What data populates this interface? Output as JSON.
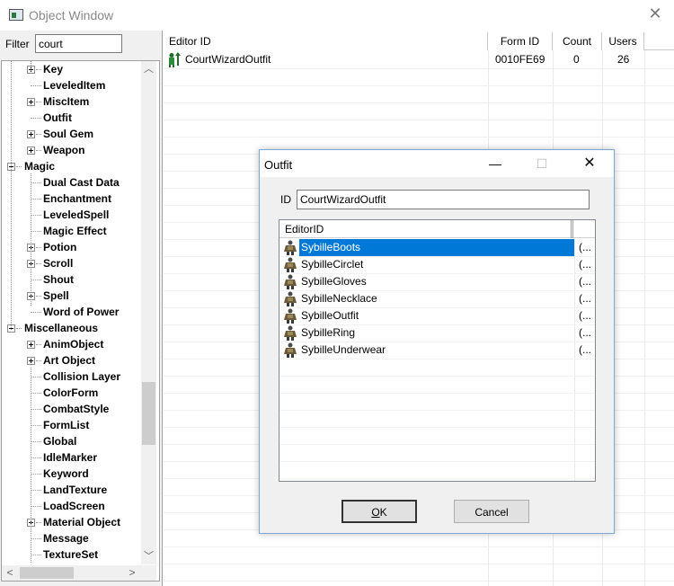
{
  "window": {
    "title": "Object Window",
    "close_glyph": "✕"
  },
  "filter": {
    "label": "Filter",
    "value": "court"
  },
  "tree": [
    {
      "label": "Key",
      "level": 1,
      "expander": "plus"
    },
    {
      "label": "LeveledItem",
      "level": 1,
      "expander": "none"
    },
    {
      "label": "MiscItem",
      "level": 1,
      "expander": "plus"
    },
    {
      "label": "Outfit",
      "level": 1,
      "expander": "none"
    },
    {
      "label": "Soul Gem",
      "level": 1,
      "expander": "plus"
    },
    {
      "label": "Weapon",
      "level": 1,
      "expander": "plus"
    },
    {
      "label": "Magic",
      "level": 0,
      "expander": "minus"
    },
    {
      "label": "Dual Cast Data",
      "level": 1,
      "expander": "none"
    },
    {
      "label": "Enchantment",
      "level": 1,
      "expander": "none"
    },
    {
      "label": "LeveledSpell",
      "level": 1,
      "expander": "none"
    },
    {
      "label": "Magic Effect",
      "level": 1,
      "expander": "none"
    },
    {
      "label": "Potion",
      "level": 1,
      "expander": "plus"
    },
    {
      "label": "Scroll",
      "level": 1,
      "expander": "plus"
    },
    {
      "label": "Shout",
      "level": 1,
      "expander": "none"
    },
    {
      "label": "Spell",
      "level": 1,
      "expander": "plus"
    },
    {
      "label": "Word of Power",
      "level": 1,
      "expander": "none"
    },
    {
      "label": "Miscellaneous",
      "level": 0,
      "expander": "minus"
    },
    {
      "label": "AnimObject",
      "level": 1,
      "expander": "plus"
    },
    {
      "label": "Art Object",
      "level": 1,
      "expander": "plus"
    },
    {
      "label": "Collision Layer",
      "level": 1,
      "expander": "none"
    },
    {
      "label": "ColorForm",
      "level": 1,
      "expander": "none"
    },
    {
      "label": "CombatStyle",
      "level": 1,
      "expander": "none"
    },
    {
      "label": "FormList",
      "level": 1,
      "expander": "none"
    },
    {
      "label": "Global",
      "level": 1,
      "expander": "none"
    },
    {
      "label": "IdleMarker",
      "level": 1,
      "expander": "none"
    },
    {
      "label": "Keyword",
      "level": 1,
      "expander": "none"
    },
    {
      "label": "LandTexture",
      "level": 1,
      "expander": "none"
    },
    {
      "label": "LoadScreen",
      "level": 1,
      "expander": "none"
    },
    {
      "label": "Material Object",
      "level": 1,
      "expander": "plus"
    },
    {
      "label": "Message",
      "level": 1,
      "expander": "none"
    },
    {
      "label": "TextureSet",
      "level": 1,
      "expander": "none"
    }
  ],
  "list": {
    "columns": [
      "Editor ID",
      "Form ID",
      "Count",
      "Users"
    ],
    "rows": [
      {
        "icon": "npc-icon",
        "editor_id": "CourtWizardOutfit",
        "form_id": "0010FE69",
        "count": "0",
        "users": "26"
      }
    ]
  },
  "dialog": {
    "title": "Outfit",
    "minimize_glyph": "—",
    "maximize_glyph": "☐",
    "close_glyph": "✕",
    "id_label": "ID",
    "id_value": "CourtWizardOutfit",
    "list_header": "EditorID",
    "items": [
      {
        "name": "SybilleBoots",
        "rest": "(...",
        "selected": true
      },
      {
        "name": "SybilleCirclet",
        "rest": "(...",
        "selected": false
      },
      {
        "name": "SybilleGloves",
        "rest": "(...",
        "selected": false
      },
      {
        "name": "SybilleNecklace",
        "rest": "(...",
        "selected": false
      },
      {
        "name": "SybilleOutfit",
        "rest": "(...",
        "selected": false
      },
      {
        "name": "SybilleRing",
        "rest": "(...",
        "selected": false
      },
      {
        "name": "SybilleUnderwear",
        "rest": "(...",
        "selected": false
      }
    ],
    "ok_label_accel": "O",
    "ok_label_rest": "K",
    "cancel_label": "Cancel"
  },
  "colors": {
    "selection": "#0078d7",
    "dialog_border": "#7fa7d6"
  }
}
